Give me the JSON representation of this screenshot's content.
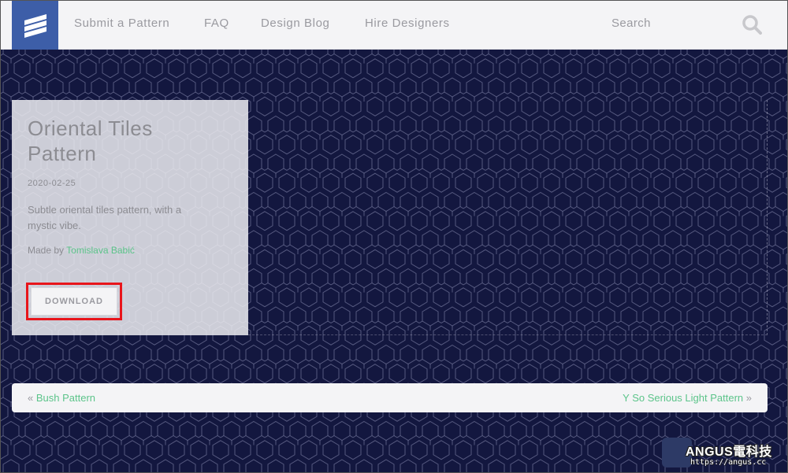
{
  "header": {
    "nav": [
      {
        "label": "Submit a Pattern"
      },
      {
        "label": "FAQ"
      },
      {
        "label": "Design Blog"
      },
      {
        "label": "Hire Designers"
      }
    ],
    "search_label": "Search"
  },
  "pattern": {
    "title": "Oriental Tiles Pattern",
    "date": "2020-02-25",
    "description": "Subtle oriental tiles pattern, with a mystic vibe.",
    "author_prefix": "Made by",
    "author_name": "Tomislava Babić",
    "download_label": "DOWNLOAD"
  },
  "pager": {
    "prev_arrow": "«",
    "prev_label": "Bush Pattern",
    "next_label": "Y So Serious Light Pattern",
    "next_arrow": "»"
  },
  "watermark": {
    "title": "ANGUS電科技",
    "url": "https://angus.cc"
  },
  "colors": {
    "background": "#13173f",
    "pattern_lines": "#8c90b4",
    "logo": "#3d5ea8",
    "link": "#5cc48a",
    "highlight": "#e8151b"
  }
}
